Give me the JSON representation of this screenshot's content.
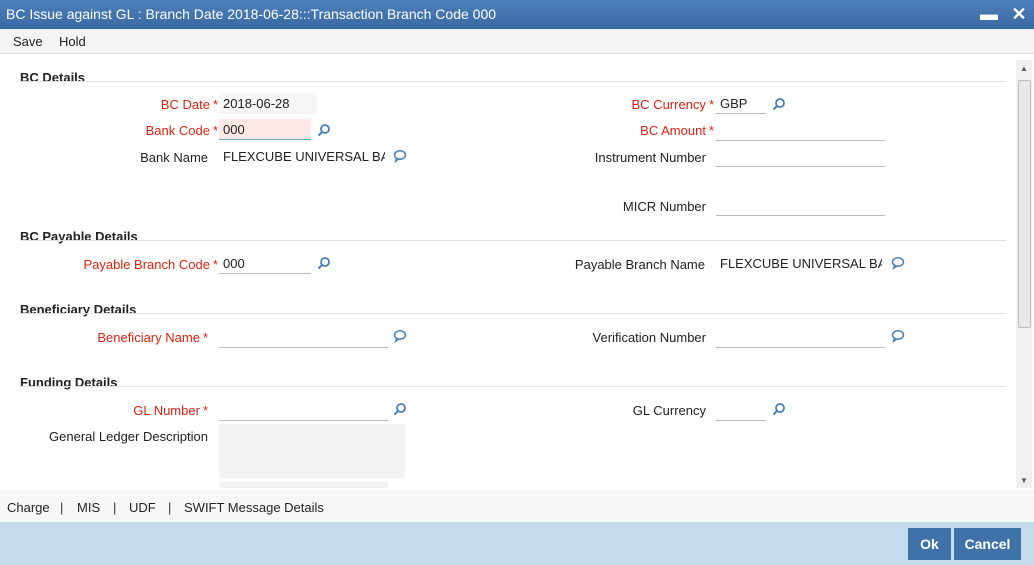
{
  "window": {
    "title": "BC Issue against GL : Branch Date 2018-06-28:::Transaction Branch Code 000",
    "minimize": "▬",
    "close": "✕"
  },
  "menu": {
    "save": "Save",
    "hold": "Hold"
  },
  "sections": {
    "bc_details": "BC Details",
    "bc_payable_details": "BC Payable Details",
    "beneficiary_details": "Beneficiary Details",
    "funding_details": "Funding Details"
  },
  "bc_details": {
    "bc_date_label": "BC Date",
    "bc_date_value": "2018-06-28",
    "bank_code_label": "Bank Code",
    "bank_code_value": "000",
    "bank_name_label": "Bank Name",
    "bank_name_value": "FLEXCUBE UNIVERSAL BA",
    "bc_currency_label": "BC Currency",
    "bc_currency_value": "GBP",
    "bc_amount_label": "BC Amount",
    "bc_amount_value": "",
    "instrument_number_label": "Instrument Number",
    "instrument_number_value": "",
    "micr_number_label": "MICR Number",
    "micr_number_value": ""
  },
  "bc_payable": {
    "payable_branch_code_label": "Payable Branch Code",
    "payable_branch_code_value": "000",
    "payable_branch_name_label": "Payable Branch Name",
    "payable_branch_name_value": "FLEXCUBE UNIVERSAL BA"
  },
  "beneficiary": {
    "beneficiary_name_label": "Beneficiary Name",
    "beneficiary_name_value": "",
    "verification_number_label": "Verification Number",
    "verification_number_value": ""
  },
  "funding": {
    "gl_number_label": "GL Number",
    "gl_number_value": "",
    "gl_currency_label": "GL Currency",
    "gl_currency_value": "",
    "gl_description_label": "General Ledger Description",
    "gl_description_value": ""
  },
  "required_marker": "*",
  "bottom_tabs": [
    "Charge",
    "MIS",
    "UDF",
    "SWIFT Message Details"
  ],
  "tab_separator": "|",
  "buttons": {
    "ok": "Ok",
    "cancel": "Cancel"
  },
  "colors": {
    "titlebar": "#3f72ad",
    "required": "#d21f1f",
    "button": "#3f73a8",
    "footer": "#c7dbef"
  },
  "icons": {
    "lookup": "search-icon",
    "narrative": "comment-icon"
  }
}
